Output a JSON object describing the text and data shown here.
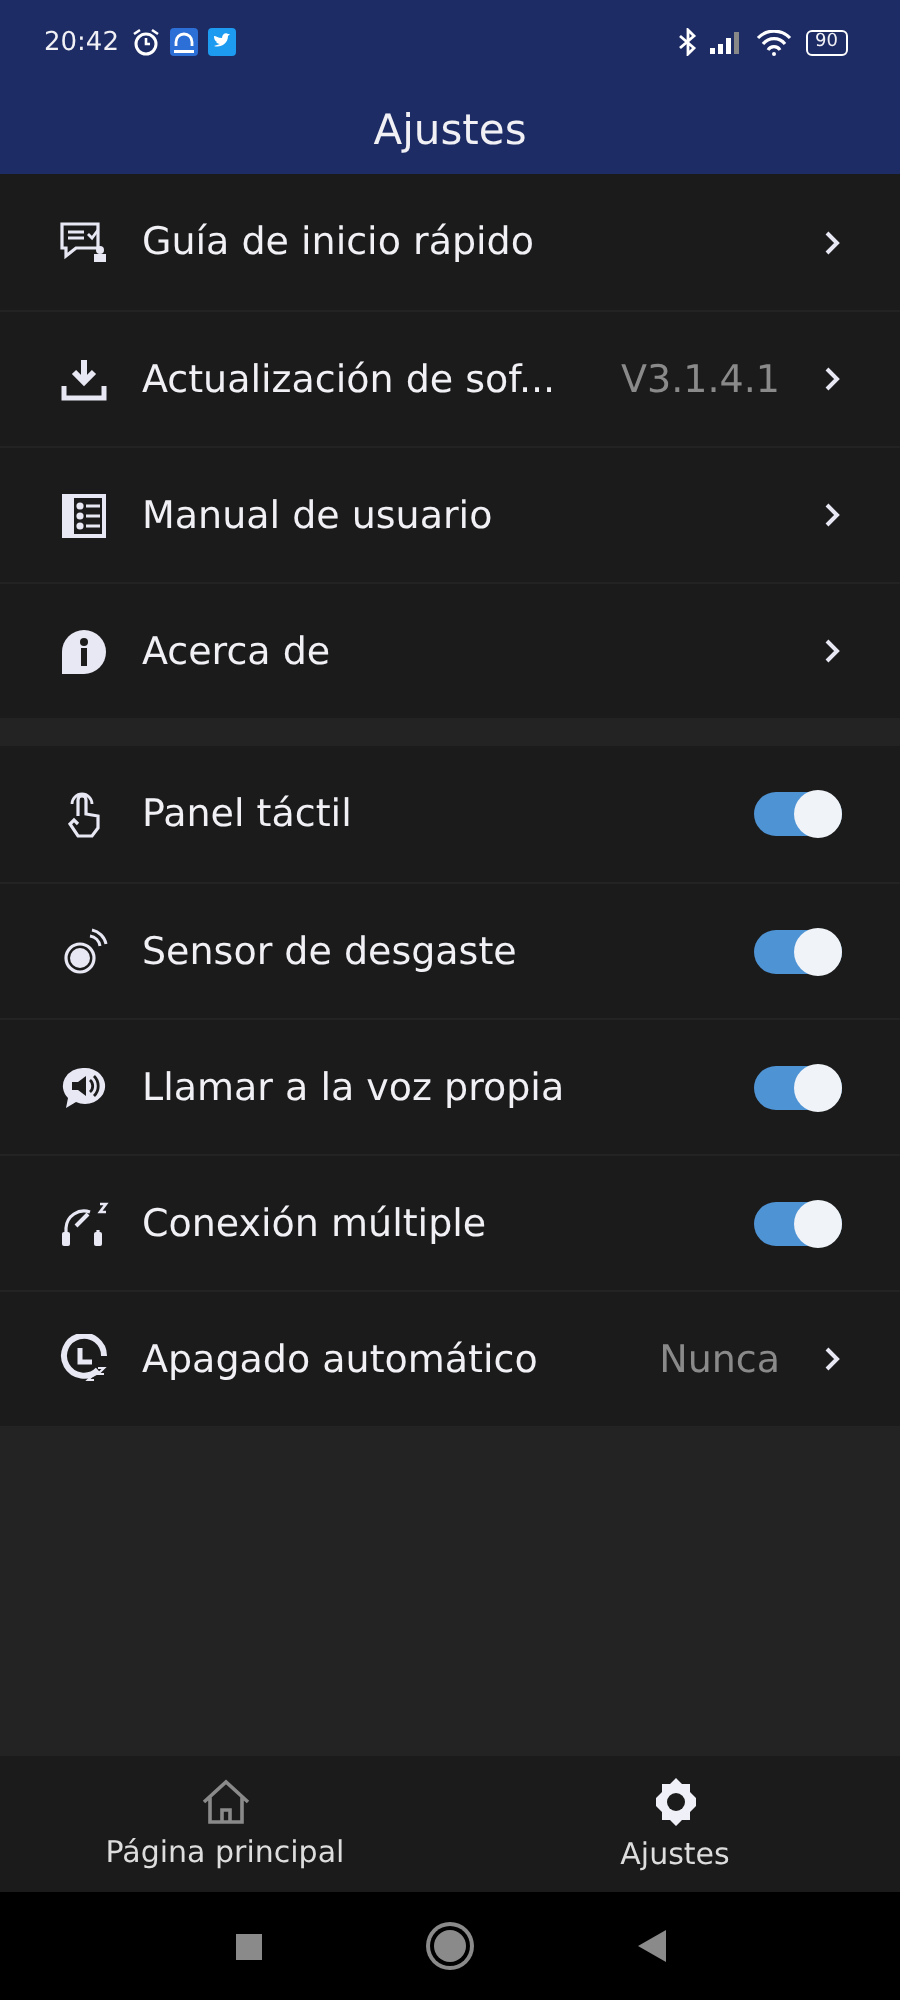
{
  "status_bar": {
    "time": "20:42",
    "battery": "90"
  },
  "header": {
    "title": "Ajustes"
  },
  "groups": [
    {
      "items": [
        {
          "label": "Guía de inicio rápido",
          "kind": "link"
        },
        {
          "label": "Actualización de sof...",
          "value": "V3.1.4.1",
          "kind": "link"
        },
        {
          "label": "Manual de usuario",
          "kind": "link"
        },
        {
          "label": "Acerca de",
          "kind": "link"
        }
      ]
    },
    {
      "items": [
        {
          "label": "Panel táctil",
          "kind": "toggle",
          "on": true
        },
        {
          "label": "Sensor de desgaste",
          "kind": "toggle",
          "on": true
        },
        {
          "label": "Llamar a la voz propia",
          "kind": "toggle",
          "on": true
        },
        {
          "label": "Conexión múltiple",
          "kind": "toggle",
          "on": true
        },
        {
          "label": "Apagado automático",
          "value": "Nunca",
          "kind": "link"
        }
      ]
    }
  ],
  "bottom_nav": [
    {
      "label": "Página principal",
      "selected": false
    },
    {
      "label": "Ajustes",
      "selected": true
    }
  ]
}
